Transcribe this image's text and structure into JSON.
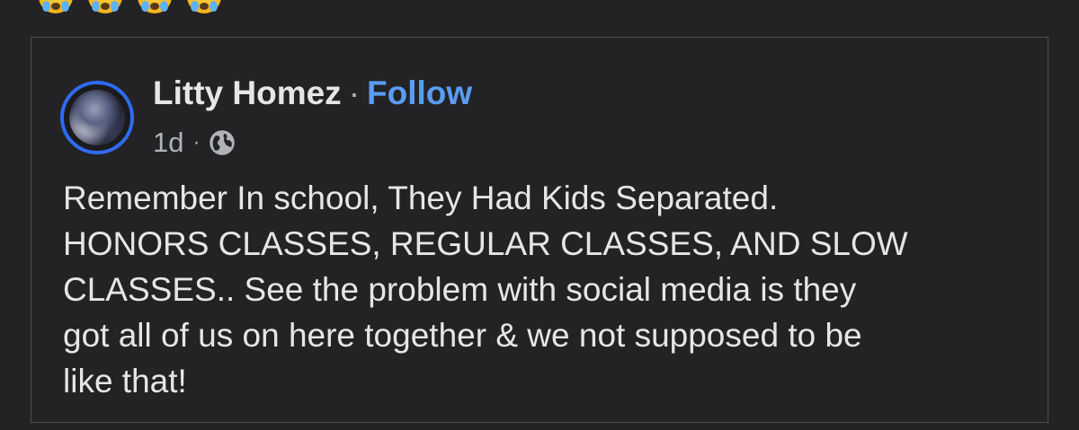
{
  "reactions": [
    {
      "icon": "crying-face-icon"
    },
    {
      "icon": "crying-face-icon"
    },
    {
      "icon": "crying-face-icon"
    },
    {
      "icon": "crying-face-icon"
    }
  ],
  "post": {
    "author": "Litty Homez",
    "separator": "·",
    "follow_label": "Follow",
    "timestamp": "1d",
    "meta_separator": "·",
    "privacy_icon": "globe-icon",
    "text": "Remember In school, They Had Kids Separated.\nHONORS CLASSES, REGULAR CLASSES, AND SLOW\nCLASSES.. See the problem with social media is they\ngot all of us on here together & we not supposed to be\nlike that!"
  },
  "colors": {
    "background": "#232325",
    "follow": "#5b9cf4",
    "avatar_ring": "#2f6bf0",
    "card_border": "#4f4f53"
  }
}
